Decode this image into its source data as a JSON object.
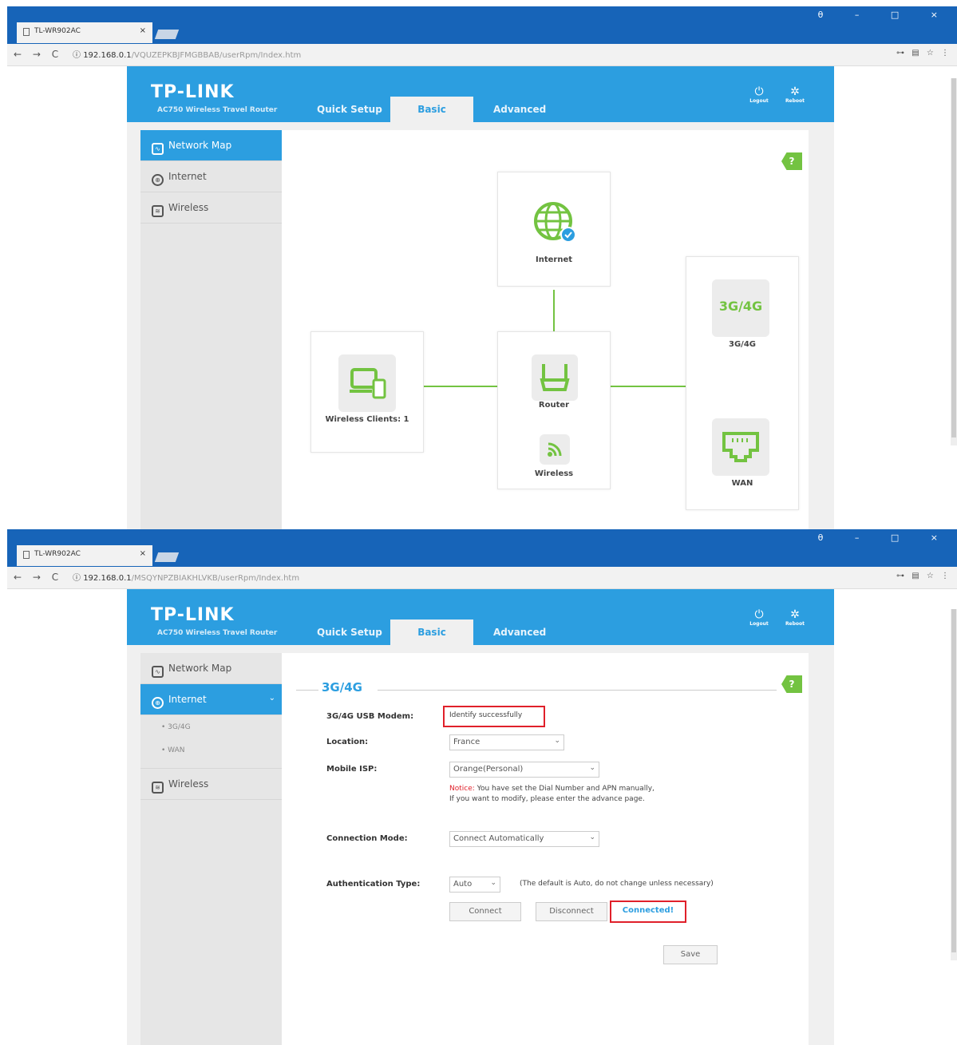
{
  "browser": {
    "tab_title": "TL-WR902AC",
    "tab_close": "×",
    "nav_buttons": "← → C",
    "window_buttons": "θ – □ ×",
    "url_host_1": "192.168.0.1",
    "url_path_1": "/VQUZEPKBJFMGBBAB/userRpm/Index.htm",
    "url_host_2": "192.168.0.1",
    "url_path_2": "/MSQYNPZBIAKHLVKB/userRpm/Index.htm",
    "right_icons": "⊶ ▤ ☆ ⋮",
    "info_icon": "ⓘ"
  },
  "header": {
    "logo": "TP-LINK",
    "subtitle": "AC750 Wireless Travel Router",
    "tabs": [
      "Quick Setup",
      "Basic",
      "Advanced"
    ],
    "logout_label": "Logout",
    "reboot_label": "Reboot",
    "logout_glyph": "⏻",
    "reboot_glyph": "✲"
  },
  "sidebar": {
    "items": [
      "Network Map",
      "Internet",
      "Wireless"
    ],
    "sub_items": [
      "3G/4G",
      "WAN"
    ],
    "chevron": "⌄"
  },
  "help": "?",
  "network_map": {
    "internet_label": "Internet",
    "router_label": "Router",
    "wireless_label": "Wireless",
    "clients_label": "Wireless Clients: 1",
    "modem_icon_text": "3G/4G",
    "modem_label": "3G/4G",
    "wan_label": "WAN"
  },
  "form_3g4g": {
    "section_title": "3G/4G",
    "modem_label": "3G/4G USB Modem:",
    "modem_status": "Identify successfully",
    "location_label": "Location:",
    "location_value": "France",
    "isp_label": "Mobile ISP:",
    "isp_value": "Orange(Personal)",
    "notice_prefix": "Notice:",
    "notice_line1": " You have set the Dial Number and APN manually,",
    "notice_line2": "If you want to modify, please enter the advance page.",
    "mode_label": "Connection Mode:",
    "mode_value": "Connect Automatically",
    "auth_label": "Authentication Type:",
    "auth_value": "Auto",
    "auth_hint": "(The default is Auto, do not change unless necessary)",
    "connect_button": "Connect",
    "disconnect_button": "Disconnect",
    "status_text": "Connected!",
    "save_button": "Save",
    "dropdown_arrow": "⌄"
  },
  "colors": {
    "brand_blue": "#2c9ee0",
    "chrome_blue": "#1764b8",
    "accent_green": "#73c341",
    "highlight_red": "#e0202a"
  }
}
